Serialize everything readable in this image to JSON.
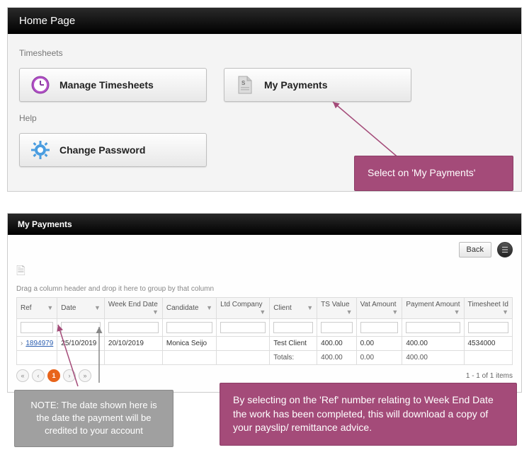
{
  "top_panel": {
    "title": "Home Page",
    "section_timesheets": "Timesheets",
    "section_help": "Help",
    "buttons": {
      "manage_timesheets": "Manage Timesheets",
      "my_payments": "My Payments",
      "change_password": "Change Password"
    }
  },
  "callouts": {
    "select_mypayments": "Select on 'My Payments'",
    "ref_explain": "By selecting on the 'Ref' number relating to Week End Date the work has been completed, this will download a copy of your payslip/ remittance advice.",
    "date_note": "NOTE: The date shown here is the date the payment will be credited to your account"
  },
  "mp": {
    "title": "My Payments",
    "back": "Back",
    "group_hint": "Drag a column header and drop it here to group by that column",
    "columns": [
      "Ref",
      "Date",
      "Week End Date",
      "Candidate",
      "Ltd Company",
      "Client",
      "TS Value",
      "Vat Amount",
      "Payment Amount",
      "Timesheet Id"
    ],
    "row": {
      "expand": "›",
      "ref": "1894979",
      "date": "25/10/2019",
      "week_end": "20/10/2019",
      "candidate": "Monica Seijo",
      "ltd": "",
      "client": "Test Client",
      "ts_value": "400.00",
      "vat": "0.00",
      "payment": "400.00",
      "timesheet_id": "4534000"
    },
    "totals": {
      "label": "Totals:",
      "ts_value": "400.00",
      "vat": "0.00",
      "payment": "400.00"
    },
    "pager": {
      "first": "«",
      "prev": "‹",
      "current": "1",
      "next": "›",
      "last": "»",
      "status": "1 - 1 of 1 items"
    }
  }
}
